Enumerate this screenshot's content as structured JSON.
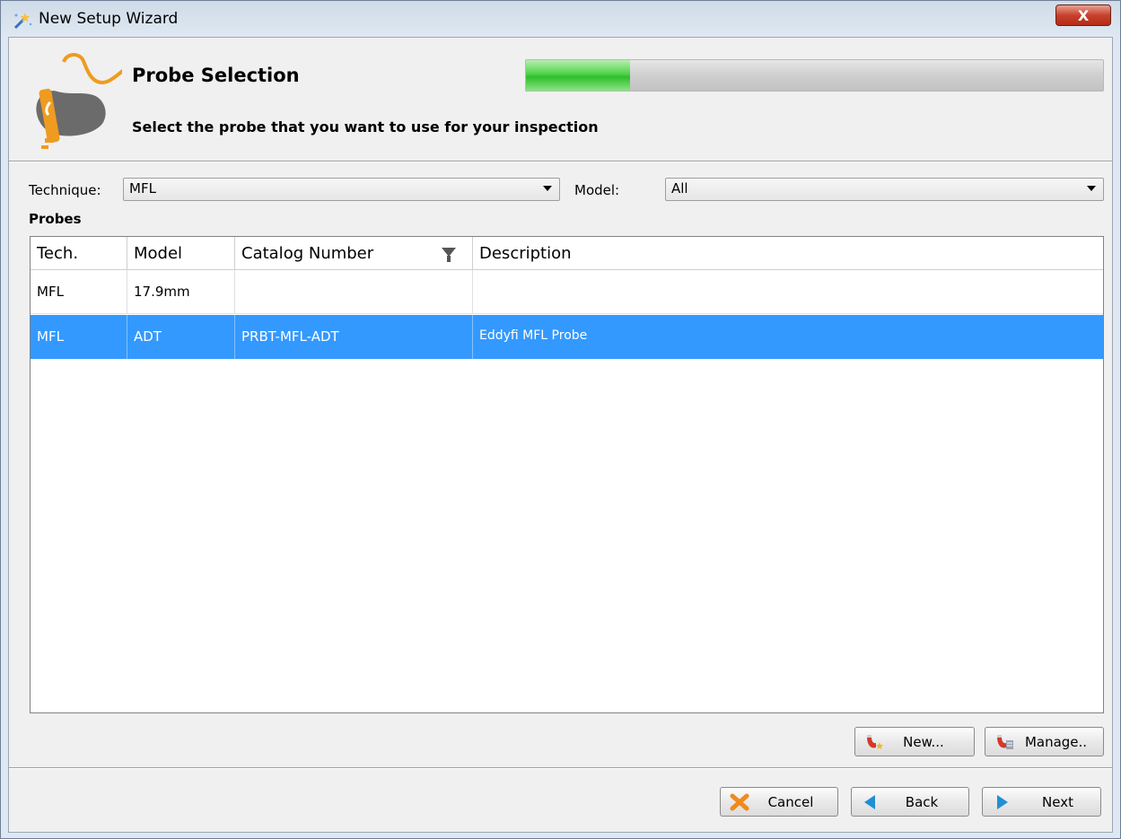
{
  "window": {
    "title": "New Setup Wizard",
    "close_label": "X"
  },
  "header": {
    "title": "Probe Selection",
    "subtitle": "Select the probe that you want to use for your inspection",
    "progress": 0.18
  },
  "filters": {
    "technique_label": "Technique:",
    "technique_value": "MFL",
    "model_label": "Model:",
    "model_value": "All"
  },
  "probes": {
    "label": "Probes",
    "columns": [
      "Tech.",
      "Model",
      "Catalog Number",
      "Description"
    ],
    "rows": [
      {
        "tech": "MFL",
        "model": "17.9mm",
        "catalog": "",
        "description": ""
      },
      {
        "tech": "MFL",
        "model": "ADT",
        "catalog": "PRBT-MFL-ADT",
        "description": "Eddyfi MFL Probe"
      }
    ]
  },
  "actions": {
    "new_label": "New...",
    "manage_label": "Manage.."
  },
  "footer": {
    "cancel_label": "Cancel",
    "back_label": "Back",
    "next_label": "Next"
  },
  "colors": {
    "selection": "#3399ff",
    "progress": "#4fd34a",
    "accent_orange": "#f0a020"
  }
}
